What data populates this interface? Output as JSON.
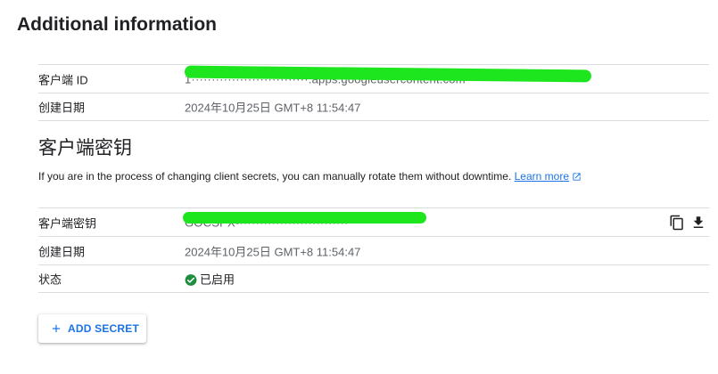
{
  "page": {
    "title": "Additional information"
  },
  "client_info": {
    "rows": [
      {
        "label": "客户端 ID",
        "value_masked": "1·····························.apps.googleusercontent.com"
      },
      {
        "label": "创建日期",
        "value": "2024年10月25日 GMT+8 11:54:47"
      }
    ]
  },
  "secrets": {
    "title": "客户端密钥",
    "description": "If you are in the process of changing client secrets, you can manually rotate them without downtime.",
    "learn_more": "Learn more",
    "rows": [
      {
        "label": "客户端密钥",
        "value_masked": "GOCSPX-···························"
      },
      {
        "label": "创建日期",
        "value": "2024年10月25日 GMT+8 11:54:47"
      },
      {
        "label": "状态",
        "value": "已启用"
      }
    ],
    "add_button": "ADD SECRET"
  },
  "colors": {
    "accent": "#1a73e8",
    "enabled_green": "#1e8e3e",
    "redaction": "#1ee61e",
    "divider": "#dadce0"
  },
  "icons": {
    "status": "check-circle-icon",
    "copy": "copy-icon",
    "download": "download-icon",
    "external": "open-in-new-icon",
    "add": "plus-icon"
  }
}
